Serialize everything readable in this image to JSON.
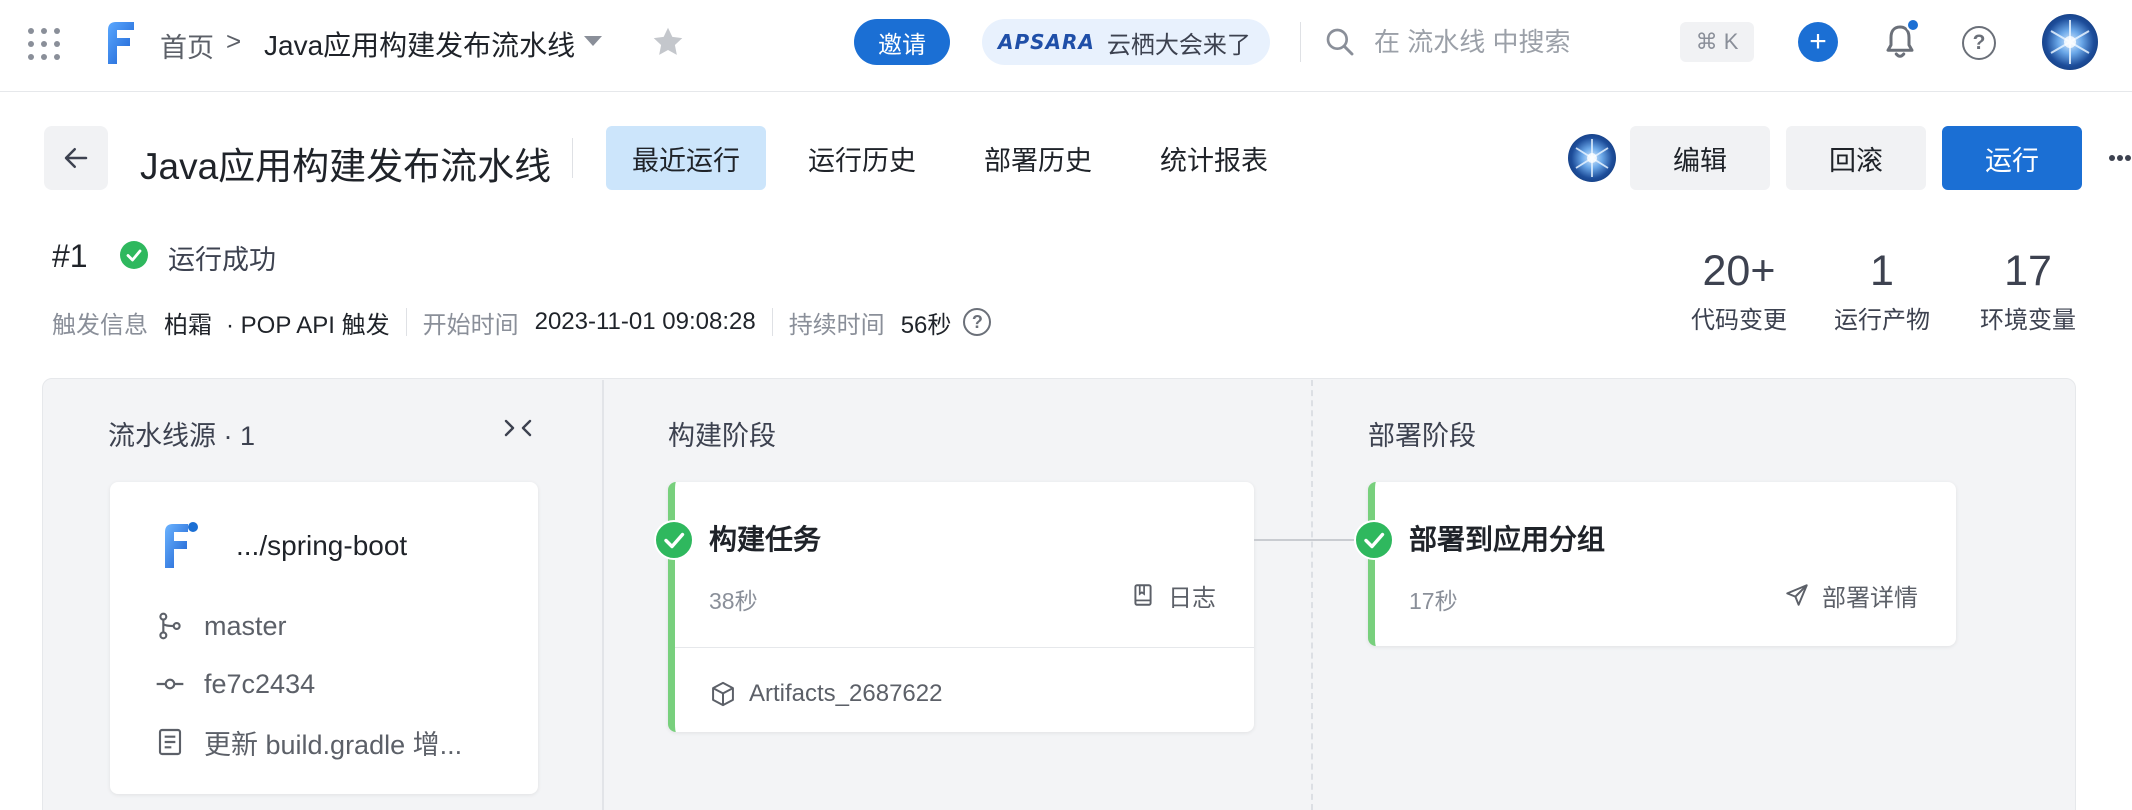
{
  "topbar": {
    "breadcrumb_home": "首页",
    "breadcrumb_sep": ">",
    "breadcrumb_current": "Java应用构建发布流水线",
    "invite_label": "邀请",
    "promo_logo": "APSARA",
    "promo_text": "云栖大会来了",
    "search_placeholder": "在 流水线 中搜索",
    "shortcut": "⌘ K",
    "plus_label": "+",
    "help_label": "?"
  },
  "header": {
    "title": "Java应用构建发布流水线",
    "tabs": [
      {
        "label": "最近运行",
        "active": true
      },
      {
        "label": "运行历史",
        "active": false
      },
      {
        "label": "部署历史",
        "active": false
      },
      {
        "label": "统计报表",
        "active": false
      }
    ],
    "buttons": {
      "edit": "编辑",
      "rollback": "回滚",
      "run": "运行"
    }
  },
  "run": {
    "number": "#1",
    "status": "运行成功",
    "trigger_label": "触发信息",
    "trigger_user": "柏霜",
    "trigger_method": "· POP API 触发",
    "start_label": "开始时间",
    "start_time": "2023-11-01 09:08:28",
    "duration_label": "持续时间",
    "duration": "56秒",
    "help_label": "?",
    "stats": [
      {
        "value": "20+",
        "label": "代码变更"
      },
      {
        "value": "1",
        "label": "运行产物"
      },
      {
        "value": "17",
        "label": "环境变量"
      }
    ]
  },
  "pipeline": {
    "source": {
      "header": "流水线源 · 1",
      "repo": ".../spring-boot",
      "branch": "master",
      "commit": "fe7c2434",
      "message": "更新 build.gradle 增..."
    },
    "build_stage": {
      "header": "构建阶段",
      "job_name": "构建任务",
      "duration": "38秒",
      "action_label": "日志",
      "artifact": "Artifacts_2687622"
    },
    "deploy_stage": {
      "header": "部署阶段",
      "job_name": "部署到应用分组",
      "duration": "17秒",
      "action_label": "部署详情"
    }
  },
  "colors": {
    "accent": "#1b6fd4",
    "tab_active_bg": "#cce5fb",
    "success": "#2fb85e",
    "job_stripe": "#78d07d"
  }
}
